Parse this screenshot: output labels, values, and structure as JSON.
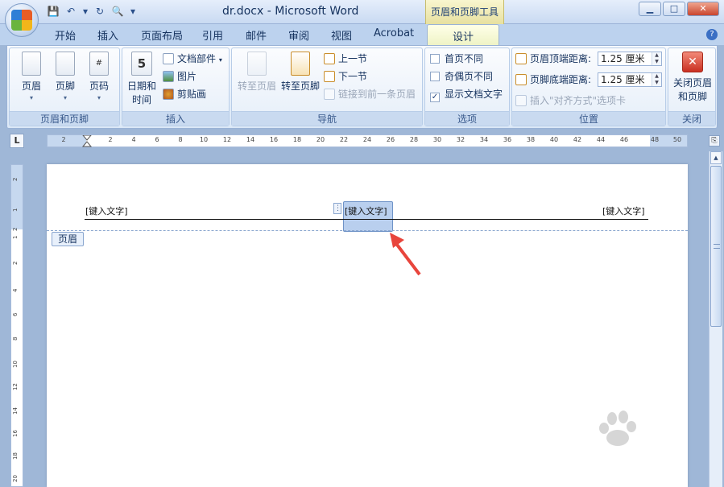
{
  "window": {
    "title": "dr.docx - Microsoft Word",
    "contextual_tools": "页眉和页脚工具",
    "controls": {
      "minimize": "▁",
      "restore": "□",
      "close": "✕"
    }
  },
  "qat": {
    "save": "💾",
    "undo": "↶",
    "undo_drop": "▾",
    "redo": "↻",
    "preview": "🔍",
    "customize": "▾"
  },
  "tabs": [
    {
      "label": "开始"
    },
    {
      "label": "插入"
    },
    {
      "label": "页面布局"
    },
    {
      "label": "引用"
    },
    {
      "label": "邮件"
    },
    {
      "label": "审阅"
    },
    {
      "label": "视图"
    },
    {
      "label": "Acrobat"
    },
    {
      "label": "设计"
    }
  ],
  "help": "?",
  "ribbon": {
    "group1": {
      "label": "页眉和页脚",
      "header": "页眉",
      "footer": "页脚",
      "pagenum": "页码",
      "arrow": "▾",
      "pagenum_glyph": "#"
    },
    "group2": {
      "label": "插入",
      "datetime_line1": "日期和",
      "datetime_line2": "时间",
      "docparts": "文档部件",
      "docparts_arrow": "▾",
      "picture": "图片",
      "clipart": "剪贴画",
      "cal_glyph": "5"
    },
    "group3": {
      "label": "导航",
      "goto_header": "转至页眉",
      "goto_footer": "转至页脚",
      "prev": "上一节",
      "next": "下一节",
      "link_prev": "链接到前一条页眉"
    },
    "group4": {
      "label": "选项",
      "first_page": "首页不同",
      "odd_even": "奇偶页不同",
      "show_doc_text": "显示文档文字",
      "checkmark": "✓"
    },
    "group5": {
      "label": "位置",
      "header_dist_label": "页眉顶端距离:",
      "header_dist_value": "1.25 厘米",
      "footer_dist_label": "页脚底端距离:",
      "footer_dist_value": "1.25 厘米",
      "insert_align_tab": "插入\"对齐方式\"选项卡"
    },
    "group6": {
      "label": "关闭",
      "close_line1": "关闭页眉",
      "close_line2": "和页脚",
      "close_glyph": "✕"
    }
  },
  "ruler": {
    "corner": "L",
    "ticks": [
      "2",
      "2",
      "4",
      "6",
      "8",
      "10",
      "12",
      "14",
      "16",
      "18",
      "20",
      "22",
      "24",
      "26",
      "28",
      "30",
      "32",
      "34",
      "36",
      "38",
      "40",
      "42",
      "44",
      "46",
      "48",
      "50"
    ],
    "vticks": [
      "2",
      "1",
      "2",
      "1",
      "2",
      "4",
      "6",
      "8",
      "10",
      "12",
      "14",
      "16",
      "18",
      "20",
      "22"
    ],
    "right_icon": "⎘"
  },
  "document": {
    "header_left": "[键入文字]",
    "header_center": "[键入文字]",
    "header_right": "[键入文字]",
    "header_tag": "页眉",
    "handle": "⋮"
  },
  "colors": {
    "accent": "#15428b",
    "arrow": "#e8453c",
    "contextual": "#eef3c5"
  }
}
